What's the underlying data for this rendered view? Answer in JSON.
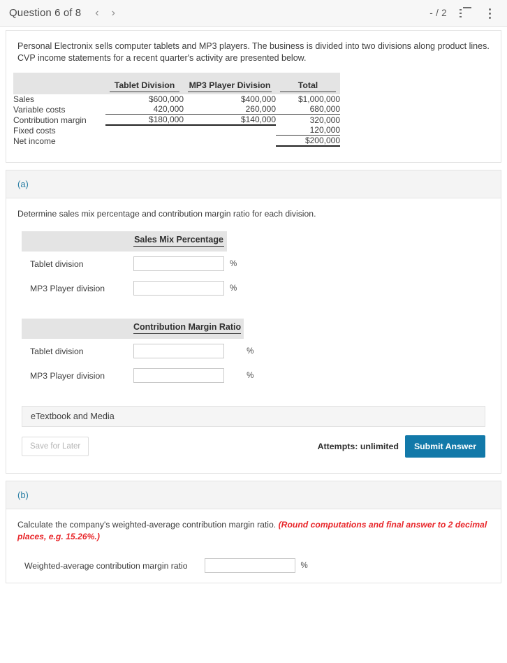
{
  "header": {
    "question_title": "Question 6 of 8",
    "prev_icon": "chevron-left-icon",
    "next_icon": "chevron-right-icon",
    "score": "- / 2",
    "list_icon": "numbered-list-icon",
    "menu_icon": "kebab-menu-icon"
  },
  "problem": {
    "intro": "Personal Electronix sells computer tablets and MP3 players. The business is divided into two divisions along product lines. CVP income statements for a recent quarter's activity are presented below.",
    "table": {
      "columns": [
        "",
        "Tablet Division",
        "MP3 Player Division",
        "Total"
      ],
      "rows": [
        {
          "label": "Sales",
          "tablet": "$600,000",
          "mp3": "$400,000",
          "total": "$1,000,000"
        },
        {
          "label": "Variable costs",
          "tablet": "420,000",
          "mp3": "260,000",
          "total": "680,000"
        },
        {
          "label": "Contribution margin",
          "tablet": "$180,000",
          "mp3": "$140,000",
          "total": "320,000"
        },
        {
          "label": "Fixed costs",
          "tablet": "",
          "mp3": "",
          "total": "120,000"
        },
        {
          "label": "Net income",
          "tablet": "",
          "mp3": "",
          "total": "$200,000"
        }
      ]
    }
  },
  "part_a": {
    "label": "(a)",
    "prompt": "Determine sales mix percentage and contribution margin ratio for each division.",
    "table1": {
      "header_label": "",
      "header_value": "Sales Mix Percentage",
      "rows": [
        {
          "label": "Tablet division",
          "value": "",
          "placeholder": "",
          "suffix": "%"
        },
        {
          "label": "MP3 Player division",
          "value": "",
          "placeholder": "",
          "suffix": "%"
        }
      ]
    },
    "table2": {
      "header_label": "",
      "header_value": "Contribution Margin Ratio",
      "rows": [
        {
          "label": "Tablet division",
          "value": "",
          "placeholder": "",
          "suffix": "%"
        },
        {
          "label": "MP3 Player division",
          "value": "",
          "placeholder": "",
          "suffix": "%"
        }
      ]
    },
    "etextbook_label": "eTextbook and Media",
    "save_label": "Save for Later",
    "attempts_label": "Attempts: unlimited",
    "submit_label": "Submit Answer"
  },
  "part_b": {
    "label": "(b)",
    "prompt_main": "Calculate the company's weighted-average contribution margin ratio. ",
    "prompt_hint": "(Round computations and final answer to 2 decimal places, e.g. 15.26%.)",
    "row": {
      "label": "Weighted-average contribution margin ratio",
      "value": "",
      "placeholder": "",
      "suffix": "%"
    }
  },
  "colors": {
    "accent_blue": "#1279a9",
    "part_label_blue": "#2b7fa5",
    "hint_red": "#e8262a",
    "table_header_gray": "#e4e4e4",
    "band_gray": "#f4f4f4"
  }
}
